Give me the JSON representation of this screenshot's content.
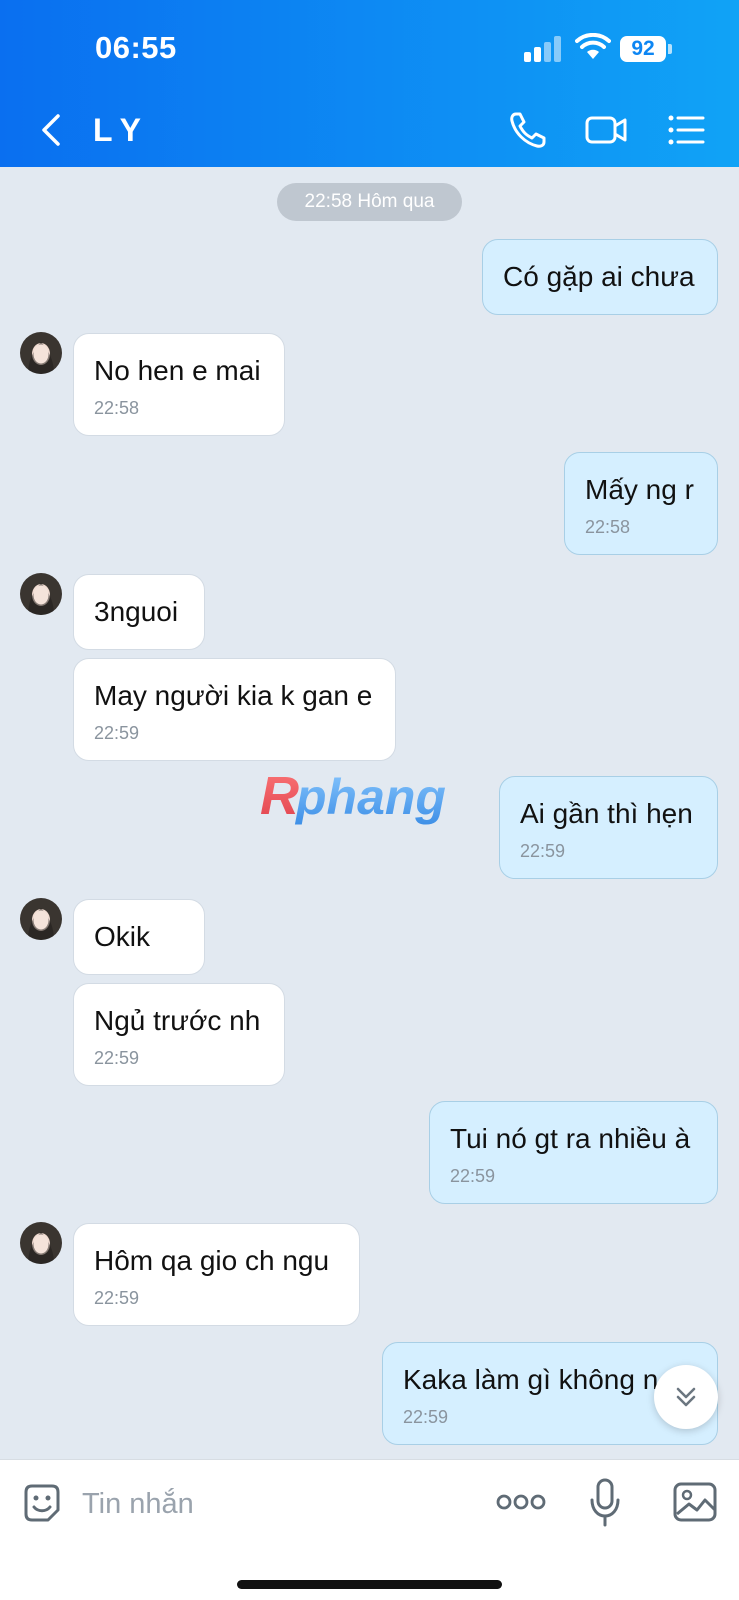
{
  "status_bar": {
    "time": "06:55",
    "battery": "92"
  },
  "header": {
    "contact_name": "LY"
  },
  "date_separator": "22:58 Hôm qua",
  "messages": [
    {
      "dir": "out",
      "text": "Có gặp ai chưa",
      "time": ""
    },
    {
      "dir": "in",
      "text": "No hen e mai",
      "time": "22:58"
    },
    {
      "dir": "out",
      "text": "Mấy ng r",
      "time": "22:58"
    },
    {
      "dir": "in",
      "text": "3nguoi",
      "time": ""
    },
    {
      "dir": "in",
      "text": "May người kia k gan e",
      "time": "22:59"
    },
    {
      "dir": "out",
      "text": "Ai gần thì hẹn",
      "time": "22:59"
    },
    {
      "dir": "in",
      "text": "Okik",
      "time": ""
    },
    {
      "dir": "in",
      "text": "Ngủ trước nh",
      "time": "22:59"
    },
    {
      "dir": "out",
      "text": "Tui nó gt ra nhiều à",
      "time": "22:59"
    },
    {
      "dir": "in",
      "text": "Hôm qa gio ch ngu",
      "time": "22:59"
    },
    {
      "dir": "out",
      "text": "Kaka làm gì không n",
      "time": "22:59"
    }
  ],
  "watermark": "Rphang",
  "composer": {
    "placeholder": "Tin nhắn"
  },
  "colors": {
    "header_start": "#0a6ff0",
    "header_end": "#10a3f6",
    "outgoing_bubble": "#d5efff",
    "incoming_bubble": "#ffffff",
    "background": "#e2e9f1"
  },
  "icons": [
    "back-icon",
    "phone-icon",
    "video-call-icon",
    "list-menu-icon",
    "sticker-icon",
    "more-icon",
    "microphone-icon",
    "image-icon",
    "chevron-down-icon"
  ]
}
